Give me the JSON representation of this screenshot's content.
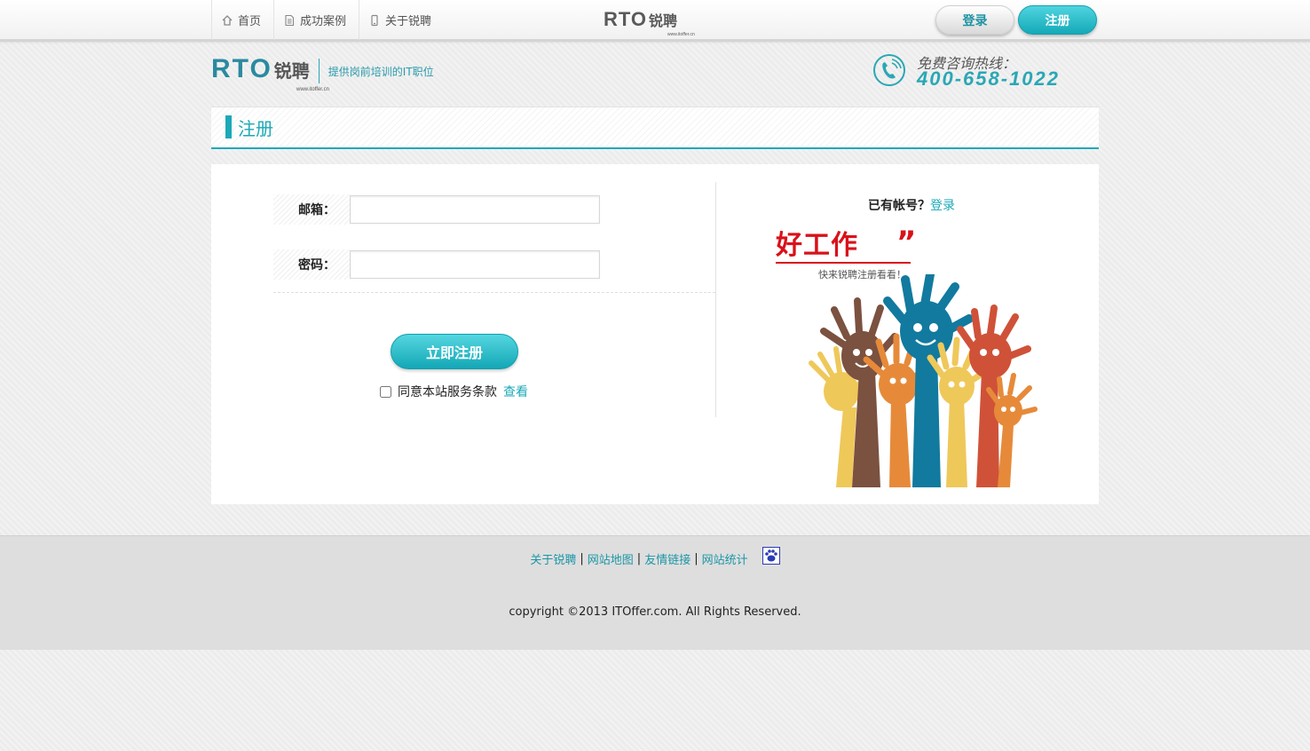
{
  "topbar": {
    "nav": [
      {
        "label": "首页",
        "icon": "home-icon"
      },
      {
        "label": "成功案例",
        "icon": "document-icon"
      },
      {
        "label": "关于锐聘",
        "icon": "phone-icon"
      }
    ],
    "logo_text": "RTO",
    "logo_cn": "锐聘",
    "logo_url": "www.itoffer.cn",
    "login_label": "登录",
    "register_label": "注册"
  },
  "header": {
    "logo_text": "RTO",
    "logo_cn": "锐聘",
    "logo_url": "www.itoffer.cn",
    "tagline": "提供岗前培训的IT职位",
    "hotline_label": "免费咨询热线：",
    "hotline_number": "400-658-1022"
  },
  "page": {
    "title": "注册"
  },
  "form": {
    "email_label": "邮箱：",
    "email_value": "",
    "password_label": "密码：",
    "password_value": "",
    "submit_label": "立即注册",
    "agree_label": "同意本站服务条款",
    "agree_checked": false,
    "view_label": "查看"
  },
  "side": {
    "has_account": "已有帐号？",
    "login_link": "登录",
    "slogan": "好工作",
    "slogan_quote": "”",
    "slogan_sub": "快来锐聘注册看看！"
  },
  "footer": {
    "links": [
      "关于锐聘",
      "网站地图",
      "友情链接",
      "网站统计"
    ],
    "separator": "|",
    "copyright": "copyright ©2013 ITOffer.com. All Rights Reserved."
  },
  "colors": {
    "accent": "#1ba9b7",
    "slogan_red": "#d9111a",
    "background": "#ececec"
  }
}
